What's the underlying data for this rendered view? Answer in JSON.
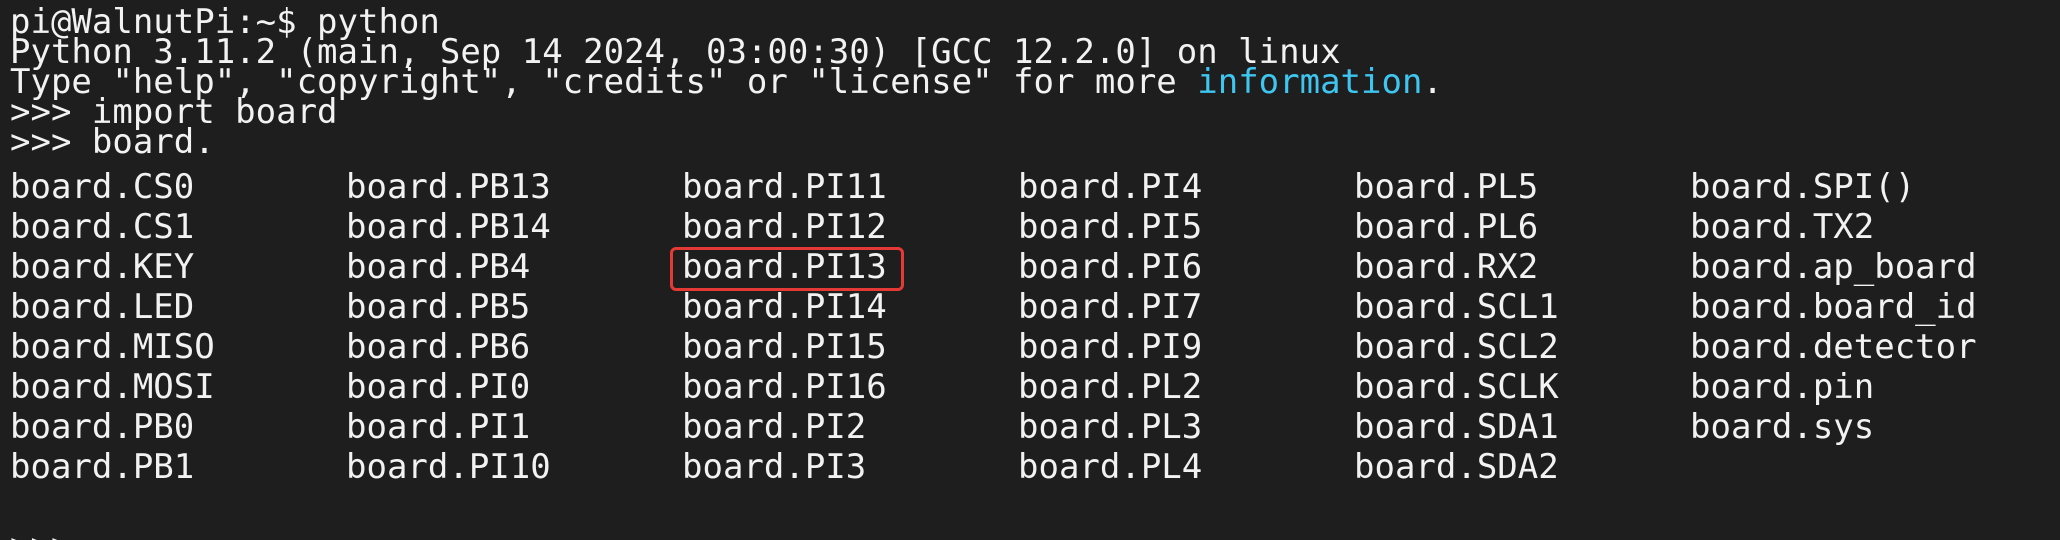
{
  "terminal": {
    "lines": [
      {
        "text": "pi@WalnutPi:~$ python"
      },
      {
        "text": "Python 3.11.2 (main, Sep 14 2024, 03:00:30) [GCC 12.2.0] on linux"
      },
      {
        "text_before": "Type \"help\", \"copyright\", \"credits\" or \"license\" for more ",
        "highlight": "information",
        "text_after": "."
      },
      {
        "text": ">>> import board"
      },
      {
        "text": ">>> board."
      }
    ],
    "completion_columns": [
      [
        "board.CS0",
        "board.CS1",
        "board.KEY",
        "board.LED",
        "board.MISO",
        "board.MOSI",
        "board.PB0",
        "board.PB1"
      ],
      [
        "board.PB13",
        "board.PB14",
        "board.PB4",
        "board.PB5",
        "board.PB6",
        "board.PI0",
        "board.PI1",
        "board.PI10"
      ],
      [
        "board.PI11",
        "board.PI12",
        "board.PI13",
        "board.PI14",
        "board.PI15",
        "board.PI16",
        "board.PI2",
        "board.PI3"
      ],
      [
        "board.PI4",
        "board.PI5",
        "board.PI6",
        "board.PI7",
        "board.PI9",
        "board.PL2",
        "board.PL3",
        "board.PL4"
      ],
      [
        "board.PL5",
        "board.PL6",
        "board.RX2",
        "board.SCL1",
        "board.SCL2",
        "board.SCLK",
        "board.SDA1",
        "board.SDA2"
      ],
      [
        "board.SPI()",
        "board.TX2",
        "board.ap_board",
        "board.board_id",
        "board.detector",
        "board.pin",
        "board.sys"
      ]
    ],
    "highlighted_item": "board.PI13",
    "last_prompt": ">>>",
    "colors": {
      "background": "#1e1e1e",
      "text": "#f2f2f2",
      "info_word": "#3fc6f0",
      "highlight_box": "#e53935"
    }
  }
}
